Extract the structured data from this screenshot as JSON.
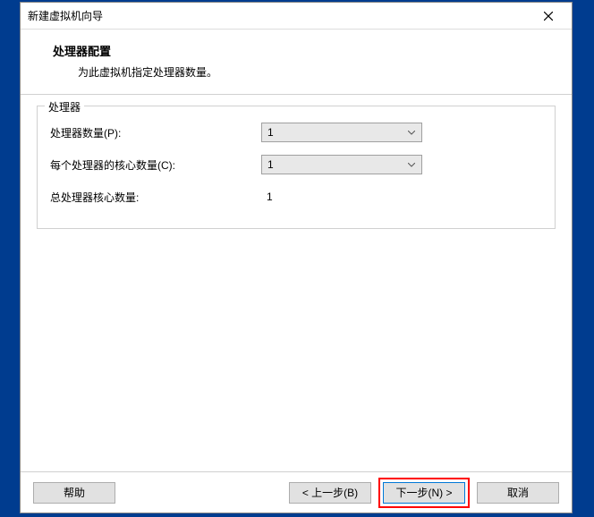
{
  "window": {
    "title": "新建虚拟机向导"
  },
  "header": {
    "title": "处理器配置",
    "subtitle": "为此虚拟机指定处理器数量。"
  },
  "group": {
    "legend": "处理器",
    "rows": {
      "processor_count_label": "处理器数量(P):",
      "processor_count_value": "1",
      "cores_per_processor_label": "每个处理器的核心数量(C):",
      "cores_per_processor_value": "1",
      "total_cores_label": "总处理器核心数量:",
      "total_cores_value": "1"
    }
  },
  "buttons": {
    "help": "帮助",
    "back": "< 上一步(B)",
    "next": "下一步(N) >",
    "cancel": "取消"
  }
}
